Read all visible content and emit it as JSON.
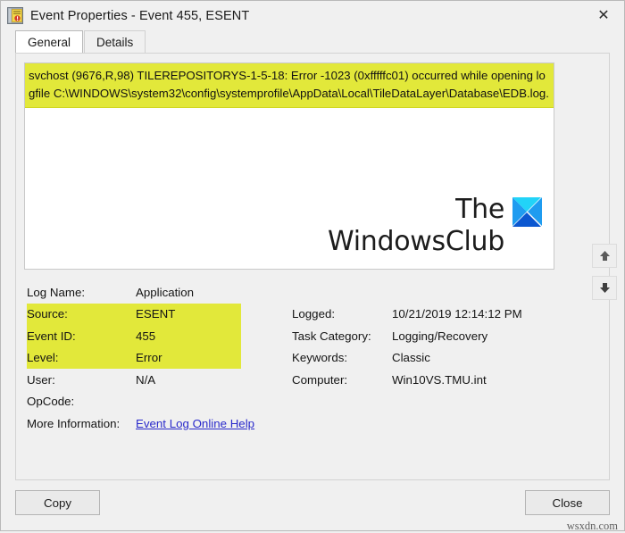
{
  "window": {
    "title": "Event Properties - Event 455, ESENT",
    "title_icon": "event-log-icon",
    "close_glyph": "✕"
  },
  "tabs": [
    {
      "label": "General",
      "active": true
    },
    {
      "label": "Details",
      "active": false
    }
  ],
  "message": {
    "text": "svchost (9676,R,98) TILEREPOSITORYS-1-5-18: Error -1023 (0xfffffc01) occurred while opening logfile C:\\WINDOWS\\system32\\config\\systemprofile\\AppData\\Local\\TileDataLayer\\Database\\EDB.log.",
    "highlight_color": "#e2e83a"
  },
  "watermark_logo": {
    "line1": "The",
    "line2": "WindowsClub",
    "mark_colors": {
      "top": "#22d3f8",
      "sides": "#1f9cf0",
      "bottom": "#0b57d0"
    }
  },
  "details_left": [
    {
      "label": "Log Name:",
      "value": "Application",
      "highlighted": false
    },
    {
      "label": "Source:",
      "value": "ESENT",
      "highlighted": true
    },
    {
      "label": "Event ID:",
      "value": "455",
      "highlighted": true
    },
    {
      "label": "Level:",
      "value": "Error",
      "highlighted": true
    },
    {
      "label": "User:",
      "value": "N/A",
      "highlighted": false
    },
    {
      "label": "OpCode:",
      "value": "",
      "highlighted": false
    },
    {
      "label": "More Information:",
      "value": "Event Log Online Help",
      "highlighted": false,
      "is_link": true
    }
  ],
  "details_right": [
    {
      "label": "Logged:",
      "value": "10/21/2019 12:14:12 PM"
    },
    {
      "label": "Task Category:",
      "value": "Logging/Recovery"
    },
    {
      "label": "Keywords:",
      "value": "Classic"
    },
    {
      "label": "Computer:",
      "value": "Win10VS.TMU.int"
    }
  ],
  "sidenav": [
    {
      "name": "previous-event-button",
      "glyph": "⬆"
    },
    {
      "name": "next-event-button",
      "glyph": "⬇"
    }
  ],
  "footer": {
    "copy_label": "Copy",
    "close_label": "Close",
    "watermark": "wsxdn.com"
  }
}
